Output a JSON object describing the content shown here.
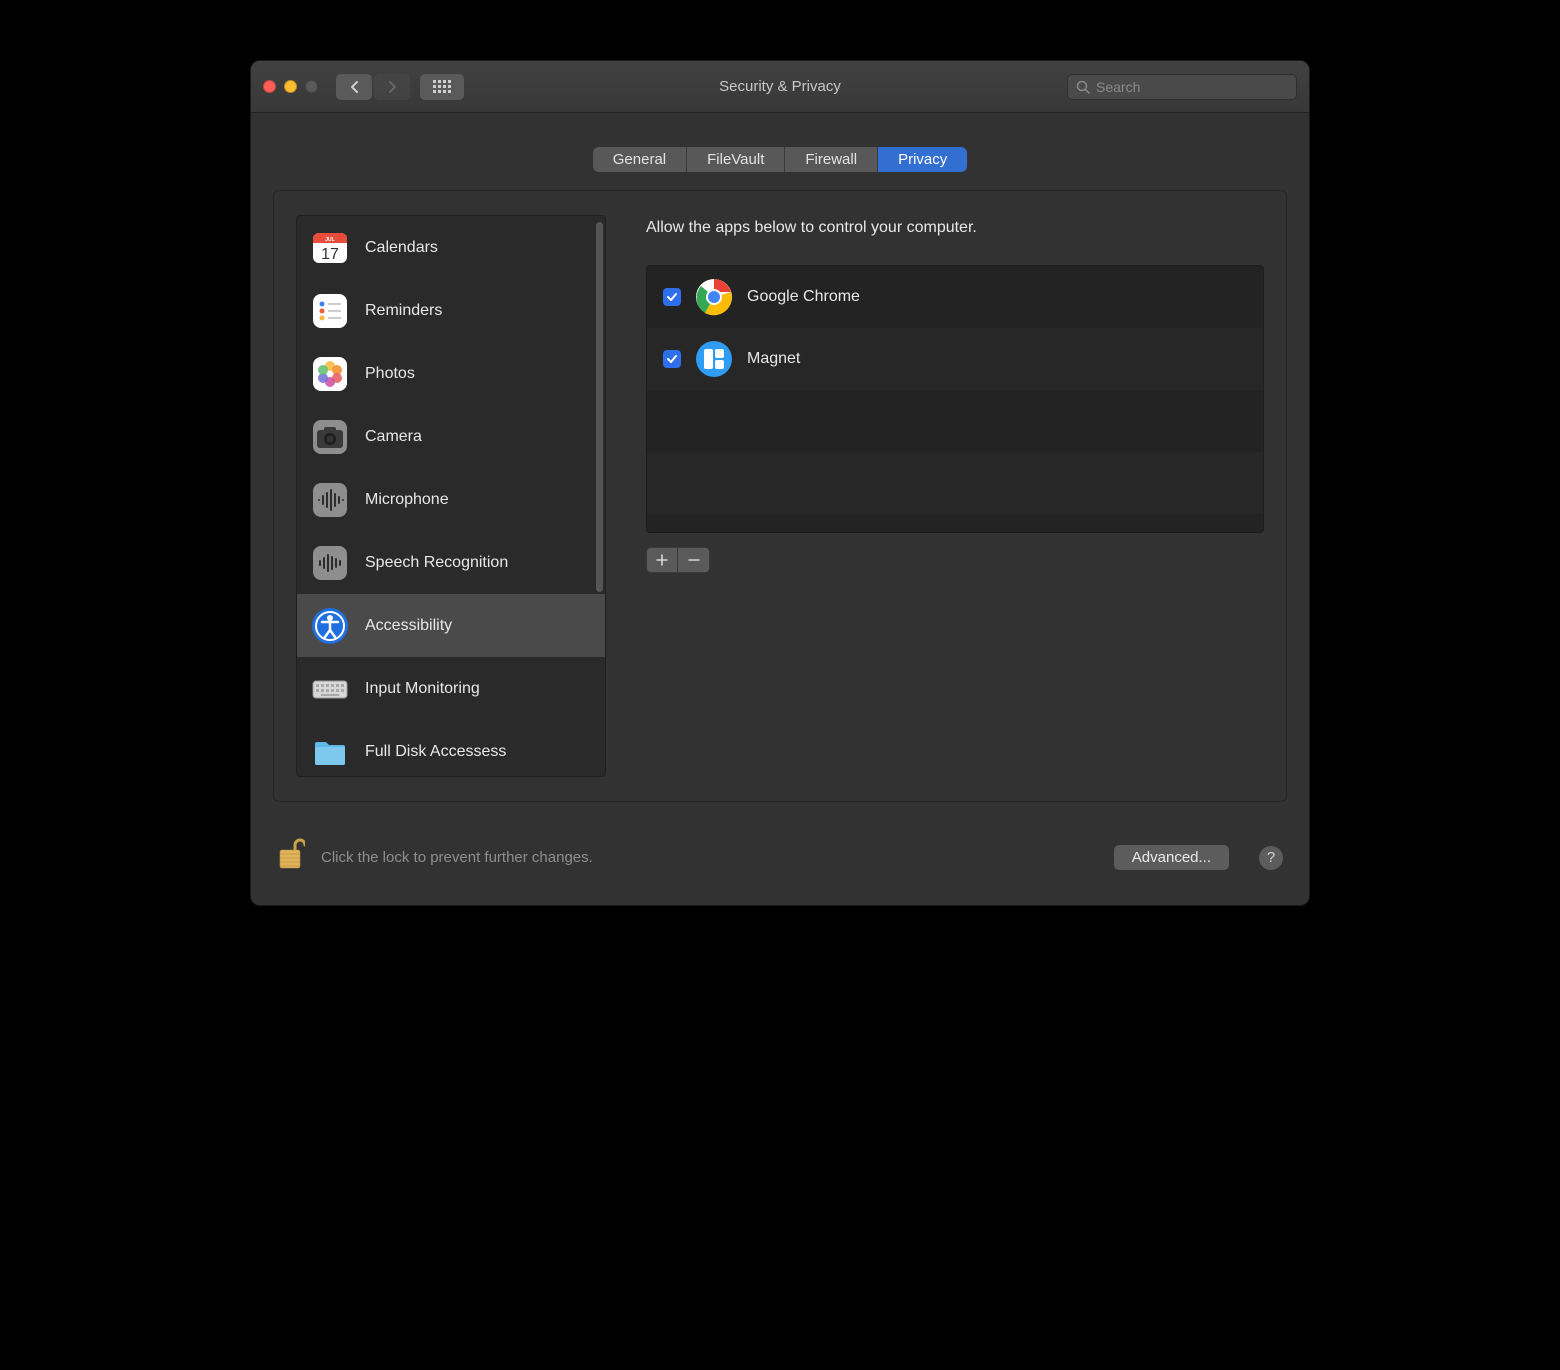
{
  "window": {
    "title": "Security & Privacy"
  },
  "search": {
    "placeholder": "Search",
    "value": ""
  },
  "tabs": [
    {
      "label": "General",
      "active": false
    },
    {
      "label": "FileVault",
      "active": false
    },
    {
      "label": "Firewall",
      "active": false
    },
    {
      "label": "Privacy",
      "active": true
    }
  ],
  "sidebar": {
    "items": [
      {
        "label": "Calendars",
        "icon": "calendar-icon",
        "selected": false
      },
      {
        "label": "Reminders",
        "icon": "reminders-icon",
        "selected": false
      },
      {
        "label": "Photos",
        "icon": "photos-icon",
        "selected": false
      },
      {
        "label": "Camera",
        "icon": "camera-icon",
        "selected": false
      },
      {
        "label": "Microphone",
        "icon": "microphone-icon",
        "selected": false
      },
      {
        "label": "Speech Recognition",
        "icon": "speech-icon",
        "selected": false
      },
      {
        "label": "Accessibility",
        "icon": "accessibility-icon",
        "selected": true
      },
      {
        "label": "Input Monitoring",
        "icon": "keyboard-icon",
        "selected": false
      },
      {
        "label": "Full Disk Accessess",
        "icon": "folder-icon",
        "selected": false
      }
    ]
  },
  "main": {
    "description": "Allow the apps below to control your computer.",
    "apps": [
      {
        "name": "Google Chrome",
        "checked": true,
        "icon": "chrome-icon"
      },
      {
        "name": "Magnet",
        "checked": true,
        "icon": "magnet-icon"
      }
    ]
  },
  "footer": {
    "lock_text": "Click the lock to prevent further changes.",
    "advanced_label": "Advanced...",
    "help_label": "?"
  }
}
